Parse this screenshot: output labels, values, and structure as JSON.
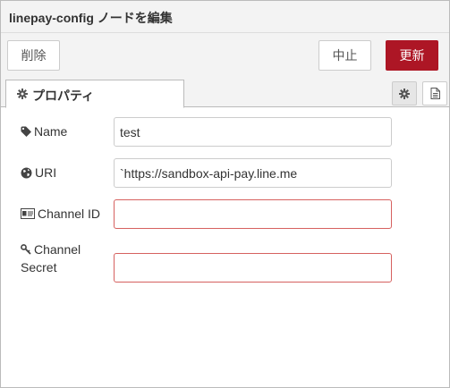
{
  "dialog": {
    "title": "linepay-config ノードを編集"
  },
  "toolbar": {
    "delete_label": "削除",
    "cancel_label": "中止",
    "update_label": "更新"
  },
  "tabs": {
    "properties_label": "プロパティ"
  },
  "form": {
    "name": {
      "label": "Name",
      "value": "test",
      "icon": "tag-icon"
    },
    "uri": {
      "label": "URI",
      "value": "`https://sandbox-api-pay.line.me",
      "icon": "globe-icon"
    },
    "channel_id": {
      "label": "Channel ID",
      "value": "",
      "icon": "id-card-icon"
    },
    "channel_secret": {
      "label_line1": "Channel",
      "label_line2": "Secret",
      "value": "",
      "icon": "key-icon"
    }
  },
  "colors": {
    "primary": "#ad1625",
    "invalid_border": "#d6615f"
  }
}
